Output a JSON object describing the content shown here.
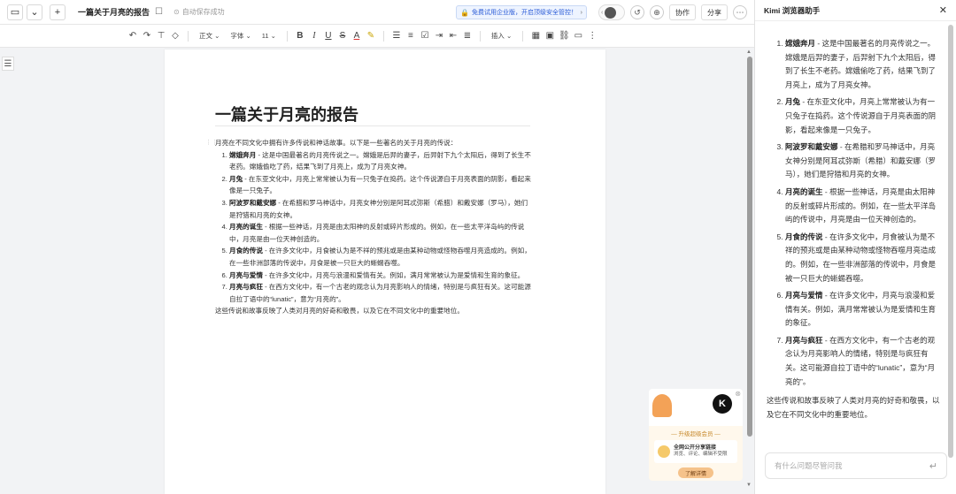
{
  "topbar": {
    "dropdown_icon": "chevron-down",
    "new_icon": "plus",
    "doc_title": "一篇关于月亮的报告",
    "autosave": "自动保存成功",
    "banner": "免费试用企业版，开启顶级安全管控！",
    "collaborate": "协作",
    "share": "分享"
  },
  "format": {
    "style": "正文",
    "font": "字体",
    "size": "11",
    "insert": "插入"
  },
  "document": {
    "heading": "一篇关于月亮的报告",
    "intro": "月亮在不同文化中拥有许多传说和神话故事。以下是一些著名的关于月亮的传说：",
    "items": [
      {
        "title": "嫦娥奔月",
        "text": " - 这是中国最著名的月亮传说之一。嫦娥是后羿的妻子，后羿射下九个太阳后，得到了长生不老药。嫦娥偷吃了药，结果飞到了月亮上，成为了月亮女神。"
      },
      {
        "title": "月兔",
        "text": " - 在东亚文化中，月亮上常常被认为有一只兔子在捣药。这个传说源自于月亮表面的阴影，看起来像是一只兔子。"
      },
      {
        "title": "阿波罗和戴安娜",
        "text": " - 在希腊和罗马神话中，月亮女神分别是阿耳忒弥斯（希腊）和戴安娜（罗马），她们是狩猎和月亮的女神。"
      },
      {
        "title": "月亮的诞生",
        "text": " - 根据一些神话，月亮是由太阳神的反射或碎片形成的。例如，在一些太平洋岛屿的传说中，月亮是由一位天神创造的。"
      },
      {
        "title": "月食的传说",
        "text": " - 在许多文化中，月食被认为是不祥的预兆或是由某种动物或怪物吞噬月亮造成的。例如，在一些非洲部落的传说中，月食是被一只巨大的蜥蜴吞噬。"
      },
      {
        "title": "月亮与爱情",
        "text": " - 在许多文化中，月亮与浪漫和爱情有关。例如，满月常常被认为是爱情和生育的象征。"
      },
      {
        "title": "月亮与疯狂",
        "text": " - 在西方文化中，有一个古老的观念认为月亮影响人的情绪，特别是与疯狂有关。这可能源自拉丁语中的“lunatic”，意为“月亮的”。"
      }
    ],
    "conclusion": "这些传说和故事反映了人类对月亮的好奇和敬畏，以及它在不同文化中的重要地位。"
  },
  "ad": {
    "title": "— 升级超级会员 —",
    "card_title": "全网公开分享链接",
    "card_sub": "浏览、评论、编辑不受限",
    "button": "了解详情"
  },
  "kimi": {
    "title": "Kimi 浏览器助手",
    "items": [
      {
        "title": "嫦娥奔月",
        "text": " - 这是中国最著名的月亮传说之一。嫦娥是后羿的妻子，后羿射下九个太阳后，得到了长生不老药。嫦娥偷吃了药，结果飞到了月亮上，成为了月亮女神。"
      },
      {
        "title": "月兔",
        "text": " - 在东亚文化中，月亮上常常被认为有一只兔子在捣药。这个传说源自于月亮表面的阴影，看起来像是一只兔子。"
      },
      {
        "title": "阿波罗和戴安娜",
        "text": " - 在希腊和罗马神话中，月亮女神分别是阿耳忒弥斯（希腊）和戴安娜（罗马），她们是狩猎和月亮的女神。"
      },
      {
        "title": "月亮的诞生",
        "text": " - 根据一些神话，月亮是由太阳神的反射或碎片形成的。例如，在一些太平洋岛屿的传说中，月亮是由一位天神创造的。"
      },
      {
        "title": "月食的传说",
        "text": " - 在许多文化中，月食被认为是不祥的预兆或是由某种动物或怪物吞噬月亮造成的。例如，在一些非洲部落的传说中，月食是被一只巨大的蜥蜴吞噬。"
      },
      {
        "title": "月亮与爱情",
        "text": " - 在许多文化中，月亮与浪漫和爱情有关。例如，满月常常被认为是爱情和生育的象征。"
      },
      {
        "title": "月亮与疯狂",
        "text": " - 在西方文化中，有一个古老的观念认为月亮影响人的情绪，特别是与疯狂有关。这可能源自拉丁语中的“lunatic”，意为“月亮的”。"
      }
    ],
    "conclusion": "这些传说和故事反映了人类对月亮的好奇和敬畏，以及它在不同文化中的重要地位。",
    "input_placeholder": "有什么问题尽管问我"
  }
}
